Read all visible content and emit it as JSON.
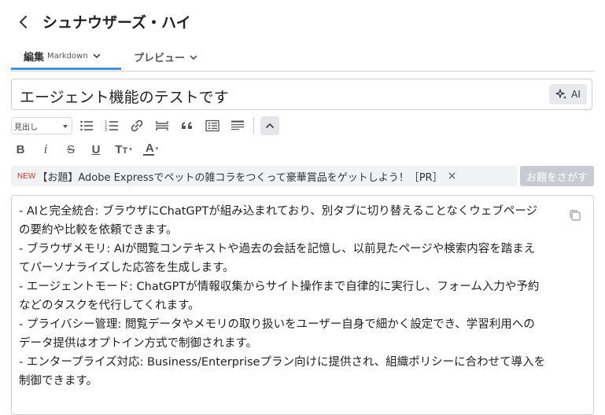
{
  "header": {
    "title": "シュナウザーズ・ハイ"
  },
  "tabs": [
    {
      "label": "編集",
      "sublabel": "Markdown"
    },
    {
      "label": "プレビュー",
      "sublabel": ""
    }
  ],
  "title_field": {
    "value": "エージェント機能のテストです"
  },
  "ai_button": {
    "label": "AI"
  },
  "toolbar": {
    "heading_select": "見出し",
    "bold": "B",
    "italic": "i",
    "strike": "S",
    "underline": "U",
    "text_size": "T",
    "font_color": "A"
  },
  "topic": {
    "badge": "NEW",
    "text": "【お題】Adobe Expressでペットの雑コラをつくって豪華賞品をゲットしよう！［PR］",
    "close": "×",
    "search_label": "お題をさがす"
  },
  "editor": {
    "lines": [
      "- AIと完全統合: ブラウザにChatGPTが組み込まれており、別タブに切り替えることなくウェブページ",
      "の要約や比較を依頼できます。",
      "- ブラウザメモリ: AIが閲覧コンテキストや過去の会話を記憶し、以前見たページや検索内容を踏まえ",
      "てパーソナライズした応答を生成します。",
      "- エージェントモード: ChatGPTが情報収集からサイト操作まで自律的に実行し、フォーム入力や予約",
      "などのタスクを代行してくれます。",
      "- プライバシー管理: 閲覧データやメモリの取り扱いをユーザー自身で細かく設定でき、学習利用への",
      "データ提供はオプトイン方式で制御されます。",
      "- エンタープライズ対応: Business/Enterpriseプラン向けに提供され、組織ポリシーに合わせて導入を",
      "制御できます。"
    ]
  },
  "colors": {
    "tab_active_underline": "#4a90d9",
    "new_badge": "#d93a2b",
    "search_button_bg": "#c8ccd2"
  }
}
